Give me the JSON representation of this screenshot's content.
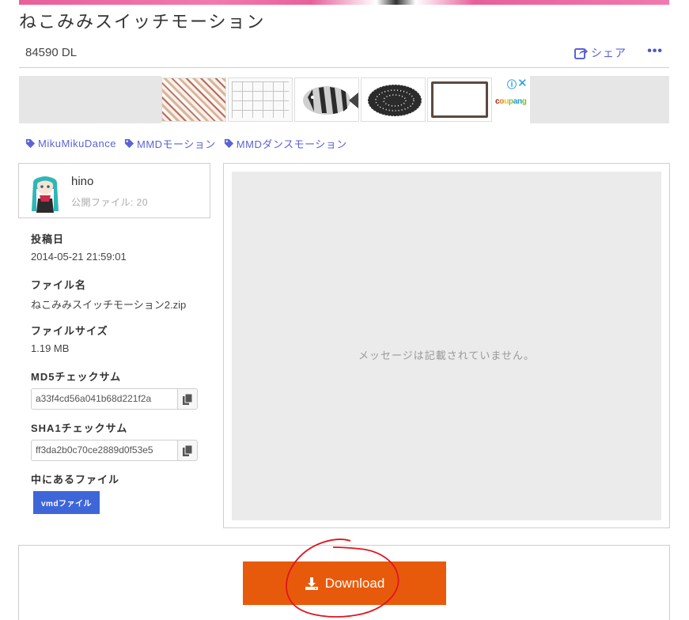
{
  "page": {
    "title": "ねこみみスイッチモーション"
  },
  "stats": {
    "downloads": "84590 DL"
  },
  "actions": {
    "share_label": "シェア",
    "more_label": "•••"
  },
  "ad": {
    "brand": "coupang",
    "adchoices": "ⓘ",
    "close": "✕"
  },
  "tags": [
    {
      "label": "MikuMikuDance"
    },
    {
      "label": "MMDモーション"
    },
    {
      "label": "MMDダンスモーション"
    }
  ],
  "user": {
    "name": "hino",
    "public_files": "公開ファイル: 20"
  },
  "file_info": {
    "posted_label": "投稿日",
    "posted_value": "2014-05-21 21:59:01",
    "filename_label": "ファイル名",
    "filename_value": "ねこみみスイッチモーション2.zip",
    "filesize_label": "ファイルサイズ",
    "filesize_value": "1.19 MB",
    "md5_label": "MD5チェックサム",
    "md5_value": "a33f4cd56a041b68d221f2a",
    "sha1_label": "SHA1チェックサム",
    "sha1_value": "ff3da2b0c70ce2889d0f53e5",
    "contents_label": "中にあるファイル",
    "contents_items": [
      "vmdファイル"
    ]
  },
  "message": {
    "text": "メッセージは記載されていません。"
  },
  "download": {
    "label": "Download"
  },
  "colors": {
    "accent": "#5b63d6",
    "download": "#e85a0b",
    "chip": "#3f66d9",
    "annotation": "#e0141e"
  }
}
